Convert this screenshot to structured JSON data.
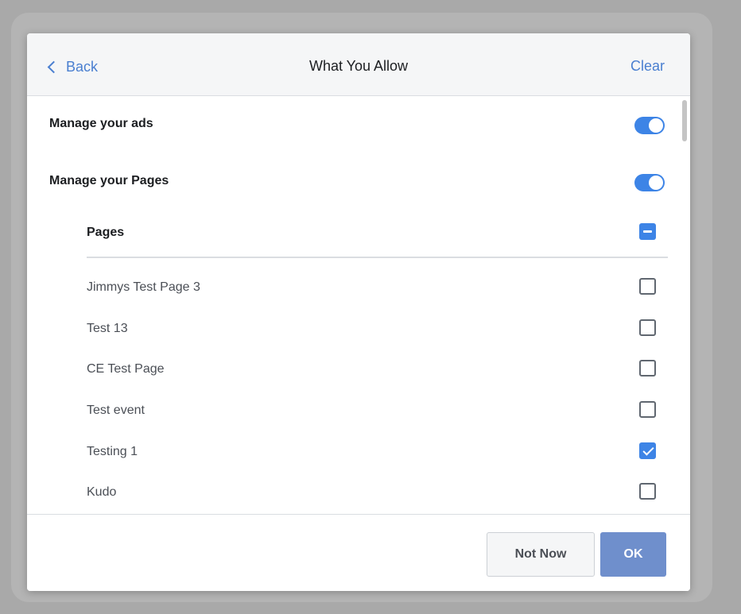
{
  "header": {
    "back_label": "Back",
    "title": "What You Allow",
    "clear_label": "Clear"
  },
  "permissions": [
    {
      "label": "Manage your ads",
      "enabled": true
    },
    {
      "label": "Manage your Pages",
      "enabled": true
    }
  ],
  "pages_section": {
    "header_label": "Pages",
    "select_all_state": "indeterminate",
    "items": [
      {
        "label": "Jimmys Test Page 3",
        "checked": false
      },
      {
        "label": "Test 13",
        "checked": false
      },
      {
        "label": "CE Test Page",
        "checked": false
      },
      {
        "label": "Test event",
        "checked": false
      },
      {
        "label": "Testing 1",
        "checked": true
      },
      {
        "label": "Kudo",
        "checked": false
      }
    ]
  },
  "footer": {
    "not_now_label": "Not Now",
    "ok_label": "OK"
  },
  "colors": {
    "accent": "#3d84e6",
    "link": "#4a7fd0",
    "ok_button": "#6f8fcc"
  },
  "icons": {
    "back": "chevron-left-icon",
    "check": "checkmark-icon",
    "indeterminate": "minus-icon"
  }
}
